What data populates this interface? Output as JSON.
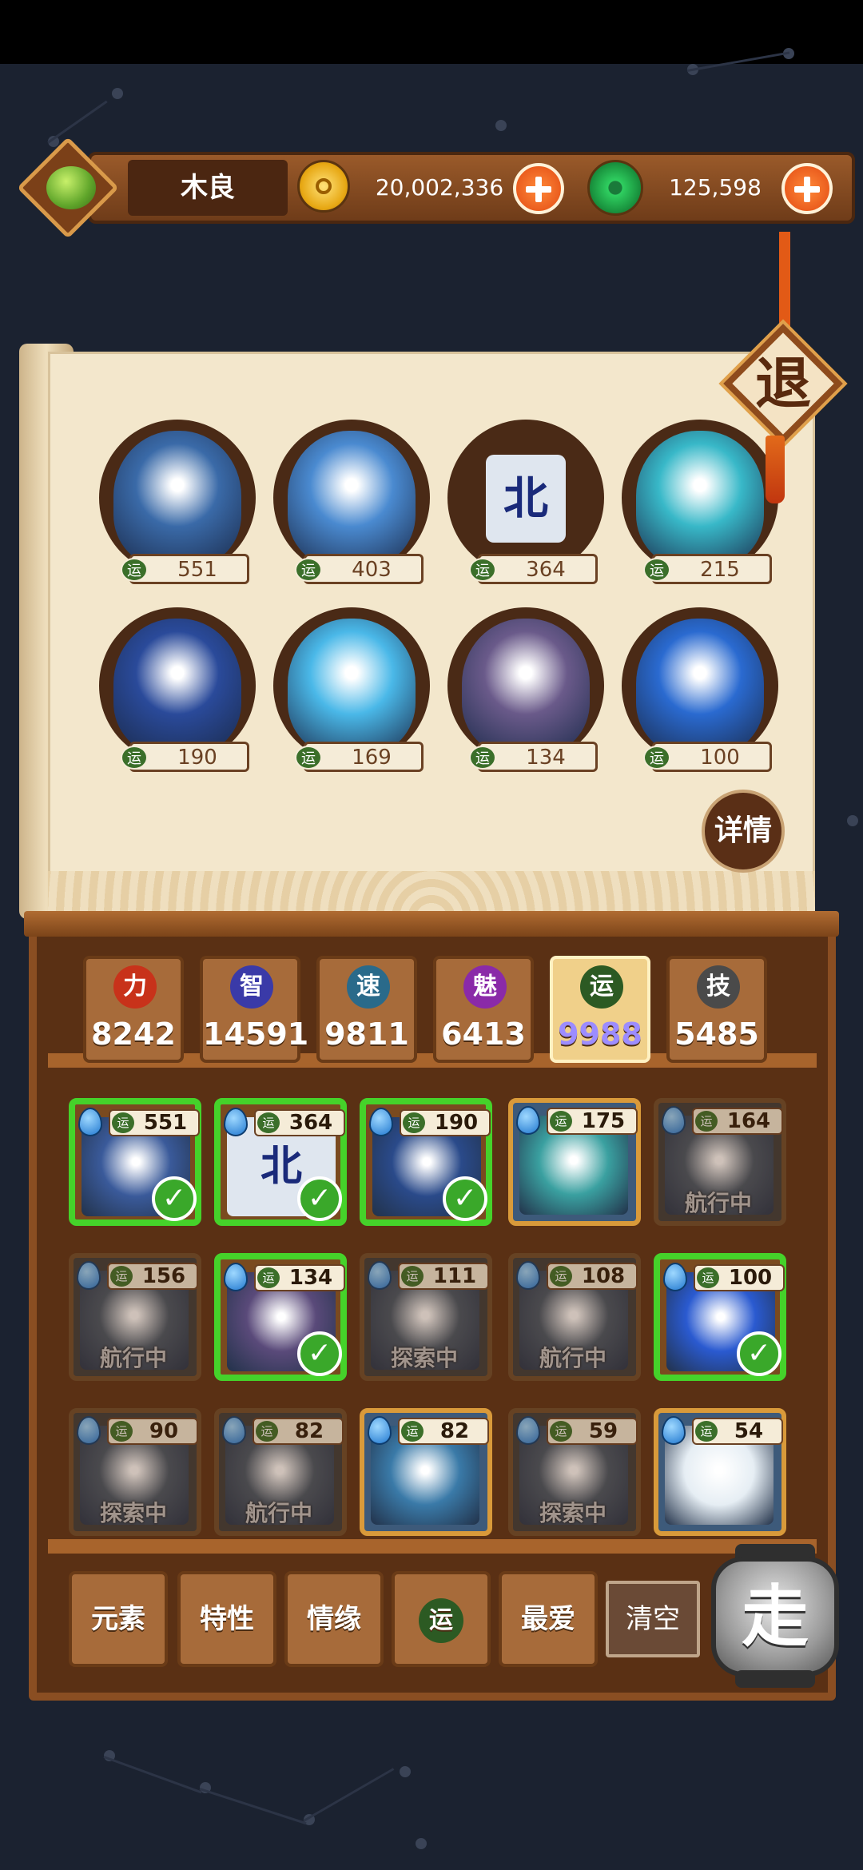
{
  "player": {
    "name": "木良"
  },
  "currency": {
    "coins": "20,002,336",
    "jade": "125,598"
  },
  "exit_label": "退",
  "detail_label": "详情",
  "luck_glyph": "运",
  "team": [
    {
      "luck": "551",
      "color": "#3a6aa8"
    },
    {
      "luck": "403",
      "color": "#4a8ad0"
    },
    {
      "luck": "364",
      "color": "#e8eef6",
      "glyph": "北"
    },
    {
      "luck": "215",
      "color": "#38b8c8"
    },
    {
      "luck": "190",
      "color": "#2a4a9a"
    },
    {
      "luck": "169",
      "color": "#4ab8e8"
    },
    {
      "luck": "134",
      "color": "#6a5a8a"
    },
    {
      "luck": "100",
      "color": "#2a6ad0"
    }
  ],
  "stats": [
    {
      "icon": "力",
      "value": "8242",
      "icon_color": "#c8321a",
      "active": false
    },
    {
      "icon": "智",
      "value": "14591",
      "icon_color": "#3a3aa8",
      "active": false
    },
    {
      "icon": "速",
      "value": "9811",
      "icon_color": "#2a6a8a",
      "active": false
    },
    {
      "icon": "魅",
      "value": "6413",
      "icon_color": "#8a2aa8",
      "active": false
    },
    {
      "icon": "运",
      "value": "9988",
      "icon_color": "#2c5a23",
      "active": true
    },
    {
      "icon": "技",
      "value": "5485",
      "icon_color": "#4a4a4a",
      "active": false
    }
  ],
  "roster": [
    {
      "luck": "551",
      "state": "selected",
      "color": "#3a5a9a"
    },
    {
      "luck": "364",
      "state": "selected",
      "color": "#dfe6ef",
      "glyph": "北"
    },
    {
      "luck": "190",
      "state": "selected",
      "color": "#2a4a8a"
    },
    {
      "luck": "175",
      "state": "normal",
      "color": "#3aa0a0"
    },
    {
      "luck": "164",
      "state": "busy",
      "color": "#445566",
      "status": "航行中"
    },
    {
      "luck": "156",
      "state": "busy",
      "color": "#445566",
      "status": "航行中"
    },
    {
      "luck": "134",
      "state": "selected",
      "color": "#5a4a7a"
    },
    {
      "luck": "111",
      "state": "busy",
      "color": "#445566",
      "status": "探索中"
    },
    {
      "luck": "108",
      "state": "busy",
      "color": "#445566",
      "status": "航行中"
    },
    {
      "luck": "100",
      "state": "selected",
      "color": "#2a5ad0"
    },
    {
      "luck": "90",
      "state": "busy",
      "color": "#445566",
      "status": "探索中"
    },
    {
      "luck": "82",
      "state": "busy",
      "color": "#445566",
      "status": "航行中"
    },
    {
      "luck": "82",
      "state": "normal",
      "color": "#3a7aa8"
    },
    {
      "luck": "59",
      "state": "busy",
      "color": "#445566",
      "status": "探索中"
    },
    {
      "luck": "54",
      "state": "normal",
      "color": "#e6eef4"
    }
  ],
  "filters": [
    "元素",
    "特性",
    "情缘",
    "运",
    "最爱"
  ],
  "clear_label": "清空",
  "go_label": "走"
}
